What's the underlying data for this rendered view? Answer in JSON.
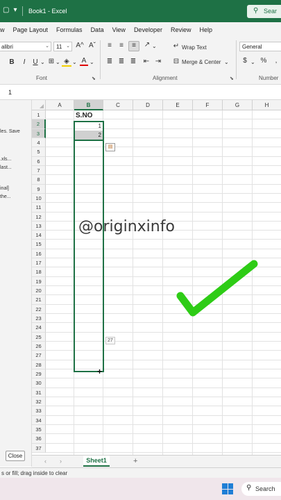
{
  "titlebar": {
    "doc_title": "Book1  -  Excel",
    "search_label": "Sear",
    "icons": [
      "save-icon",
      "undo-icon",
      "customize-qat-icon"
    ]
  },
  "menu": [
    "w",
    "Page Layout",
    "Formulas",
    "Data",
    "View",
    "Developer",
    "Review",
    "Help"
  ],
  "ribbon": {
    "font_name": "alibri",
    "font_size": "11",
    "grow_font": "A^",
    "shrink_font": "Aˇ",
    "bold": "B",
    "italic": "I",
    "underline": "U",
    "font_color_letter": "A",
    "wrap_text": "Wrap Text",
    "merge_center": "Merge & Center",
    "number_format": "General",
    "currency": "$",
    "percent": "%",
    "group_font": "Font",
    "group_alignment": "Alignment",
    "group_number": "Number"
  },
  "formula_bar": {
    "value": "1"
  },
  "left_pane": {
    "lines": [
      "les.  Save",
      ".xls...",
      "last...",
      "inal]",
      "the..."
    ],
    "close_label": "Close"
  },
  "grid": {
    "columns": [
      "A",
      "B",
      "C",
      "D",
      "E",
      "F",
      "G",
      "H"
    ],
    "rows": [
      "1",
      "2",
      "3",
      "4",
      "5",
      "6",
      "7",
      "8",
      "9",
      "10",
      "11",
      "12",
      "13",
      "14",
      "15",
      "16",
      "17",
      "18",
      "19",
      "20",
      "21",
      "22",
      "23",
      "24",
      "25",
      "26",
      "27",
      "28",
      "29",
      "30",
      "31",
      "32",
      "33",
      "34",
      "35",
      "36",
      "37"
    ],
    "active_column": "B",
    "header_cell": "S.NO",
    "values": [
      "1",
      "2"
    ],
    "fill_tooltip": "27"
  },
  "overlay": {
    "watermark": "@originxinfo",
    "check_color": "#2ecc16"
  },
  "sheets": {
    "tab": "Sheet1",
    "add": "+"
  },
  "status": {
    "text": "s or fill; drag inside to clear"
  },
  "taskbar": {
    "search_label": "Search"
  },
  "colors": {
    "excel_green": "#1e7145",
    "selection": "#1e7145"
  }
}
